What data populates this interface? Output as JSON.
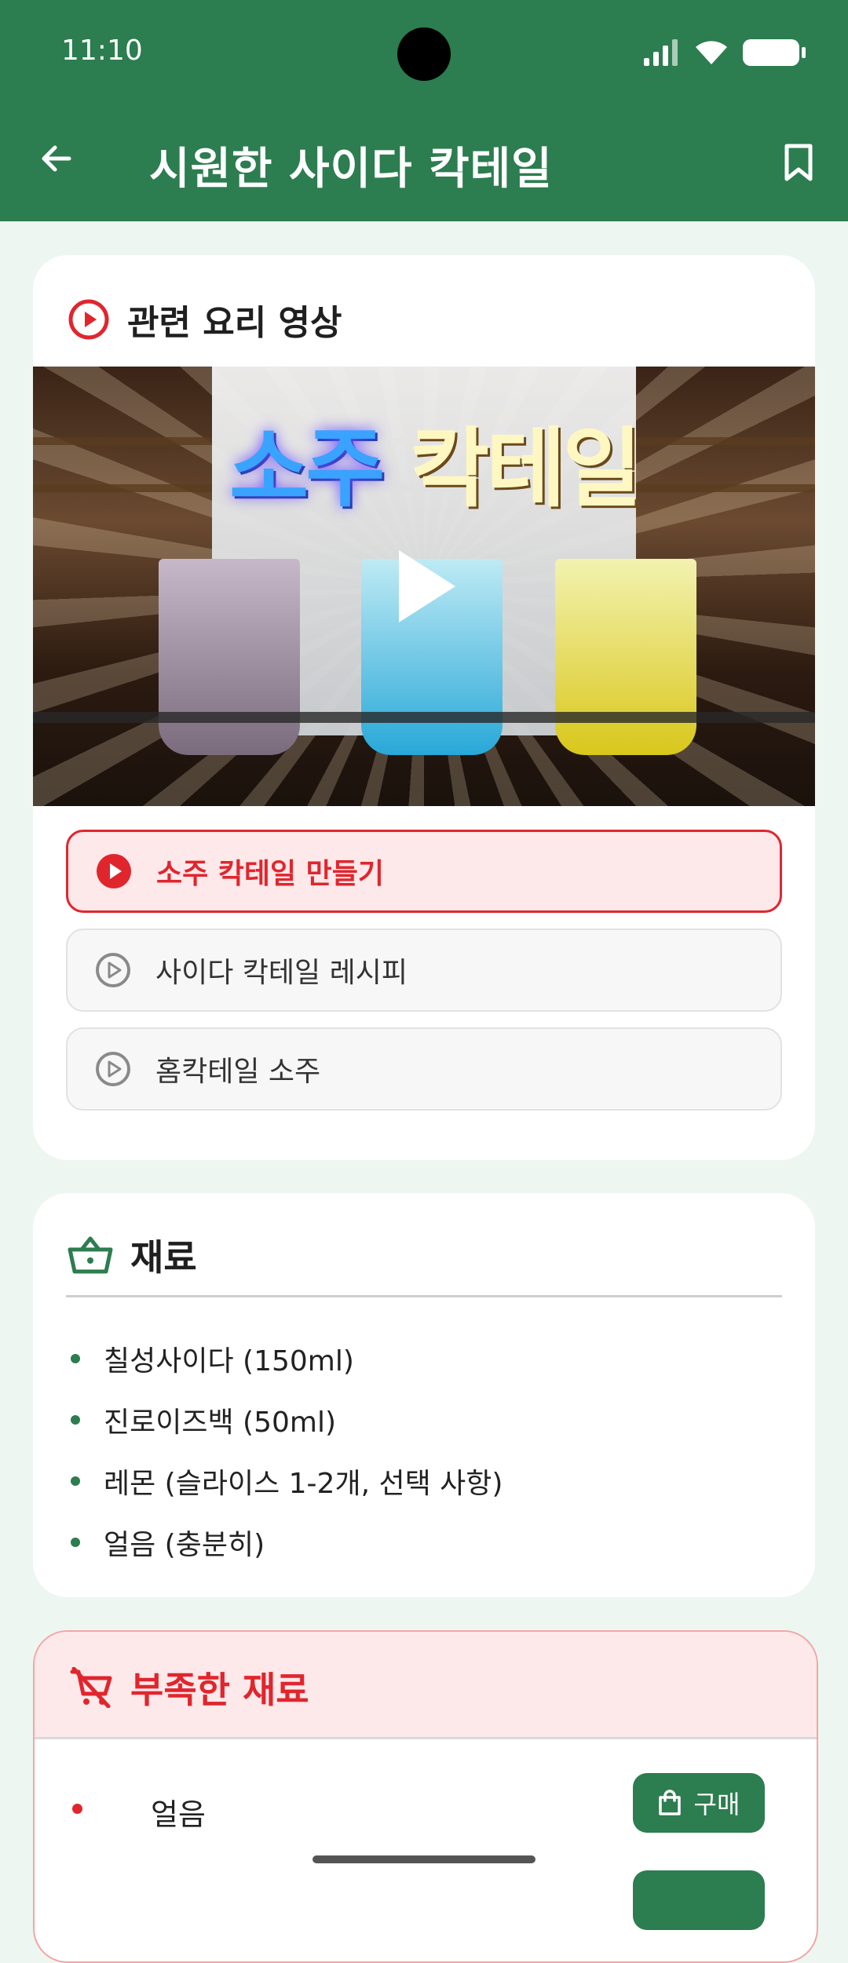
{
  "status_bar": {
    "time": "11:10"
  },
  "app_bar": {
    "title": "시원한 사이다 칵테일"
  },
  "video_section": {
    "title": "관련 요리 영상",
    "thumbnail_text_a": "소주",
    "thumbnail_text_b": "칵테일",
    "videos": [
      {
        "label": "소주 칵테일 만들기",
        "active": true
      },
      {
        "label": "사이다 칵테일 레시피",
        "active": false
      },
      {
        "label": "홈칵테일 소주",
        "active": false
      }
    ]
  },
  "ingredients": {
    "title": "재료",
    "items": [
      "칠성사이다 (150ml)",
      "진로이즈백 (50ml)",
      "레몬 (슬라이스 1-2개, 선택 사항)",
      "얼음 (충분히)"
    ]
  },
  "missing": {
    "title": "부족한 재료",
    "items": [
      {
        "name": "얼음",
        "buy_label": "구매"
      }
    ]
  },
  "colors": {
    "primary": "#2C7D4F",
    "accent_red": "#E0262D",
    "background": "#EEF6F1"
  }
}
